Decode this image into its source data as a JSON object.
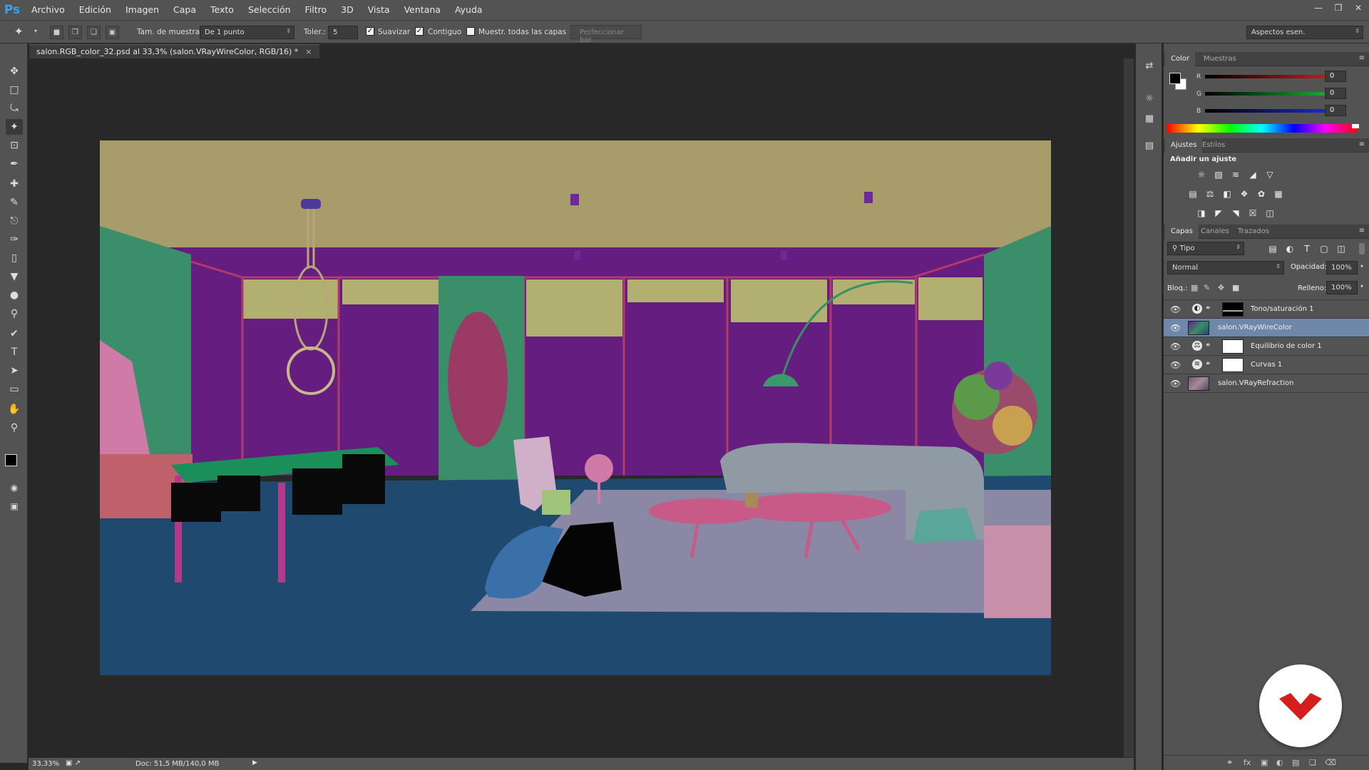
{
  "app": {
    "logo": "Ps"
  },
  "menu": [
    "Archivo",
    "Edición",
    "Imagen",
    "Capa",
    "Texto",
    "Selección",
    "Filtro",
    "3D",
    "Vista",
    "Ventana",
    "Ayuda"
  ],
  "options": {
    "sample_size_label": "Tam. de muestra:",
    "sample_size_value": "De 1 punto",
    "tolerance_label": "Toler.:",
    "tolerance_value": "5",
    "antialias_label": "Suavizar",
    "contiguous_label": "Contiguo",
    "sample_all_label": "Muestr. todas las capas",
    "refine_edge_label": "Perfeccionar bor.",
    "workspace_value": "Aspectos esen."
  },
  "document": {
    "tab_title": "salon.RGB_color_32.psd al 33,3% (salon.VRayWireColor, RGB/16) *",
    "zoom": "33,33%",
    "doc_size": "Doc: 51,5 MB/140,0 MB"
  },
  "color_panel": {
    "tabs": [
      "Color",
      "Muestras"
    ],
    "channels": [
      {
        "name": "R",
        "value": "0",
        "color": "#d02020"
      },
      {
        "name": "G",
        "value": "0",
        "color": "#20b040"
      },
      {
        "name": "B",
        "value": "0",
        "color": "#2030d0"
      }
    ]
  },
  "adjustments_panel": {
    "tabs": [
      "Ajustes",
      "Estilos"
    ],
    "heading": "Añadir un ajuste",
    "icons_row1": [
      "brightness-icon",
      "levels-icon",
      "curves-icon",
      "exposure-icon",
      "gradient-map-icon"
    ],
    "icons_row2": [
      "vibrance-icon",
      "balance-icon",
      "bw-icon",
      "photo-filter-icon",
      "channel-mixer-icon",
      "color-lookup-icon"
    ],
    "icons_row3": [
      "invert-icon",
      "posterize-icon",
      "threshold-icon",
      "selective-color-icon",
      "gradient-icon"
    ]
  },
  "layers_panel": {
    "tabs": [
      "Capas",
      "Canales",
      "Trazados"
    ],
    "filter_value": "Tipo",
    "blend_mode": "Normal",
    "opacity_label": "Opacidad:",
    "opacity_value": "100%",
    "lock_label": "Bloq.:",
    "fill_label": "Relleno:",
    "fill_value": "100%",
    "layers": [
      {
        "name": "Tono/saturación 1",
        "kind": "adjustment",
        "selected": false
      },
      {
        "name": "salon.VRayWireColor",
        "kind": "image",
        "selected": true
      },
      {
        "name": "Equilibrio de color 1",
        "kind": "adjustment",
        "selected": false
      },
      {
        "name": "Curvas 1",
        "kind": "adjustment",
        "selected": false
      },
      {
        "name": "salon.VRayRefraction",
        "kind": "image",
        "selected": false
      }
    ]
  }
}
